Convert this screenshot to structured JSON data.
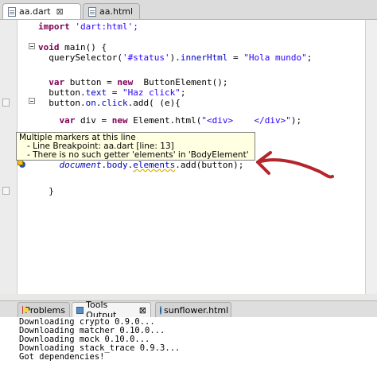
{
  "editor_tabs": [
    {
      "label": "aa.dart",
      "close": "⊠",
      "active": true
    },
    {
      "label": "aa.html",
      "active": false
    }
  ],
  "code": {
    "line1": [
      "import ",
      "'dart:html';"
    ],
    "line2": [
      "void ",
      "main() {"
    ],
    "line3": [
      "  querySelector(",
      "'#status'",
      ").",
      "innerHtml",
      " = ",
      "\"Hola mundo\"",
      ";"
    ],
    "line4": [
      "  ",
      "var",
      " button = ",
      "new",
      "  ButtonElement();"
    ],
    "line5": [
      "  button.",
      "text",
      " = ",
      "\"Haz click\"",
      ";"
    ],
    "line6": [
      "  button.",
      "on",
      ".",
      "click",
      ".add( (e){"
    ],
    "line7": [
      "    ",
      "var",
      " div = ",
      "new",
      " Element.html(",
      "\"<div>    </div>\"",
      ");"
    ],
    "line8": [
      "    ",
      "document",
      ".",
      "body",
      ".",
      "elements",
      ".add(button);"
    ],
    "line9": "  }"
  },
  "tooltip": {
    "title": "Multiple markers at this line",
    "item1": "- Line Breakpoint: aa.dart [line: 13]",
    "item2": "- There is no such getter 'elements' in 'BodyElement'"
  },
  "bottom_tabs": [
    {
      "label": "Problems",
      "icon": "problems-icon"
    },
    {
      "label": "Tools Output",
      "icon": "tools-output-icon",
      "close": "⊠",
      "active": true
    },
    {
      "label": "sunflower.html",
      "icon": "web-icon"
    }
  ],
  "console_lines": [
    "Downloading crypto 0.9.0...",
    "Downloading matcher 0.10.0...",
    "Downloading mock 0.10.0...",
    "Downloading stack_trace 0.9.3...",
    "Got dependencies!"
  ],
  "colors": {
    "keyword": "#7f0055",
    "string": "#2a00ff",
    "field": "#0000c0",
    "annotation_arrow": "#b3262a",
    "tooltip_bg": "#ffffe1"
  }
}
